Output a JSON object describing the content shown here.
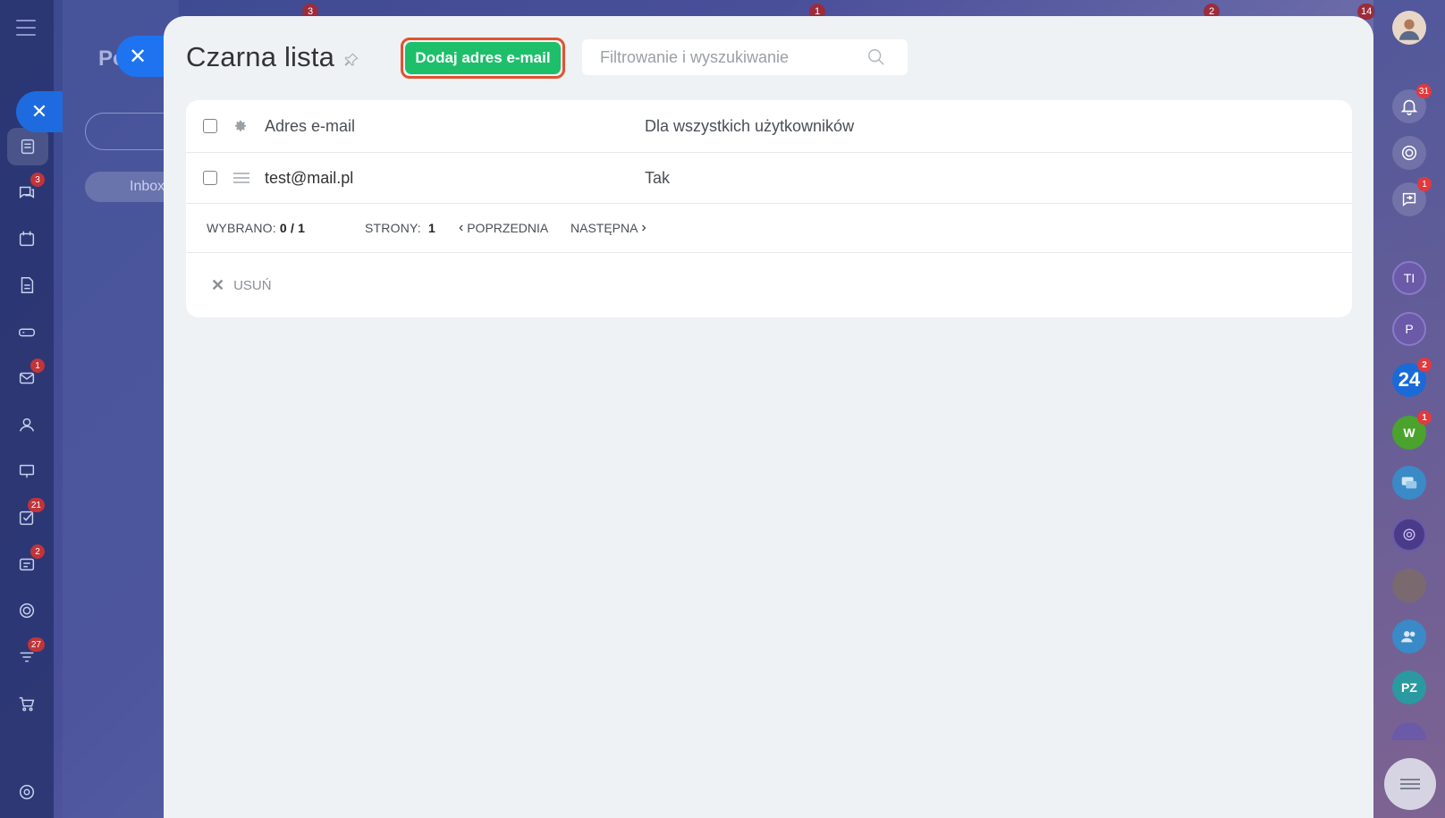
{
  "slider": {
    "title": "Czarna lista",
    "add_button_label": "Dodaj adres e-mail",
    "search_placeholder": "Filtrowanie i wyszukiwanie"
  },
  "table": {
    "columns": [
      "Adres e-mail",
      "Dla wszystkich użytkowników"
    ],
    "rows": [
      {
        "email": "test@mail.pl",
        "all_users": "Tak"
      }
    ],
    "pager": {
      "selected_label": "WYBRANO:",
      "selected_value": "0 / 1",
      "pages_label": "STRONY:",
      "pages_value": "1",
      "prev_label": "POPRZEDNIA",
      "next_label": "NASTĘPNA"
    },
    "delete_label": "USUŃ"
  },
  "left_rail": {
    "badges": {
      "chat": "3",
      "mail": "1",
      "tasks": "21",
      "crm": "2",
      "feed": "27"
    }
  },
  "behind": {
    "title": "Po",
    "inbox_label": "Inbox"
  },
  "top_badges": [
    "3",
    "1",
    "2",
    "14"
  ],
  "right_rail": {
    "notifications_badge": "31",
    "sync_badge": "1",
    "b24_label": "24",
    "b24_badge": "2",
    "w_label": "W",
    "w_badge": "1",
    "avatar_ti": "TI",
    "avatar_p": "P",
    "avatar_pz": "PZ"
  },
  "colors": {
    "accent_green": "#1dbf6a",
    "highlight_red": "#e3522f",
    "close_blue": "#1e74f0",
    "badge_red": "#e03a3e"
  }
}
